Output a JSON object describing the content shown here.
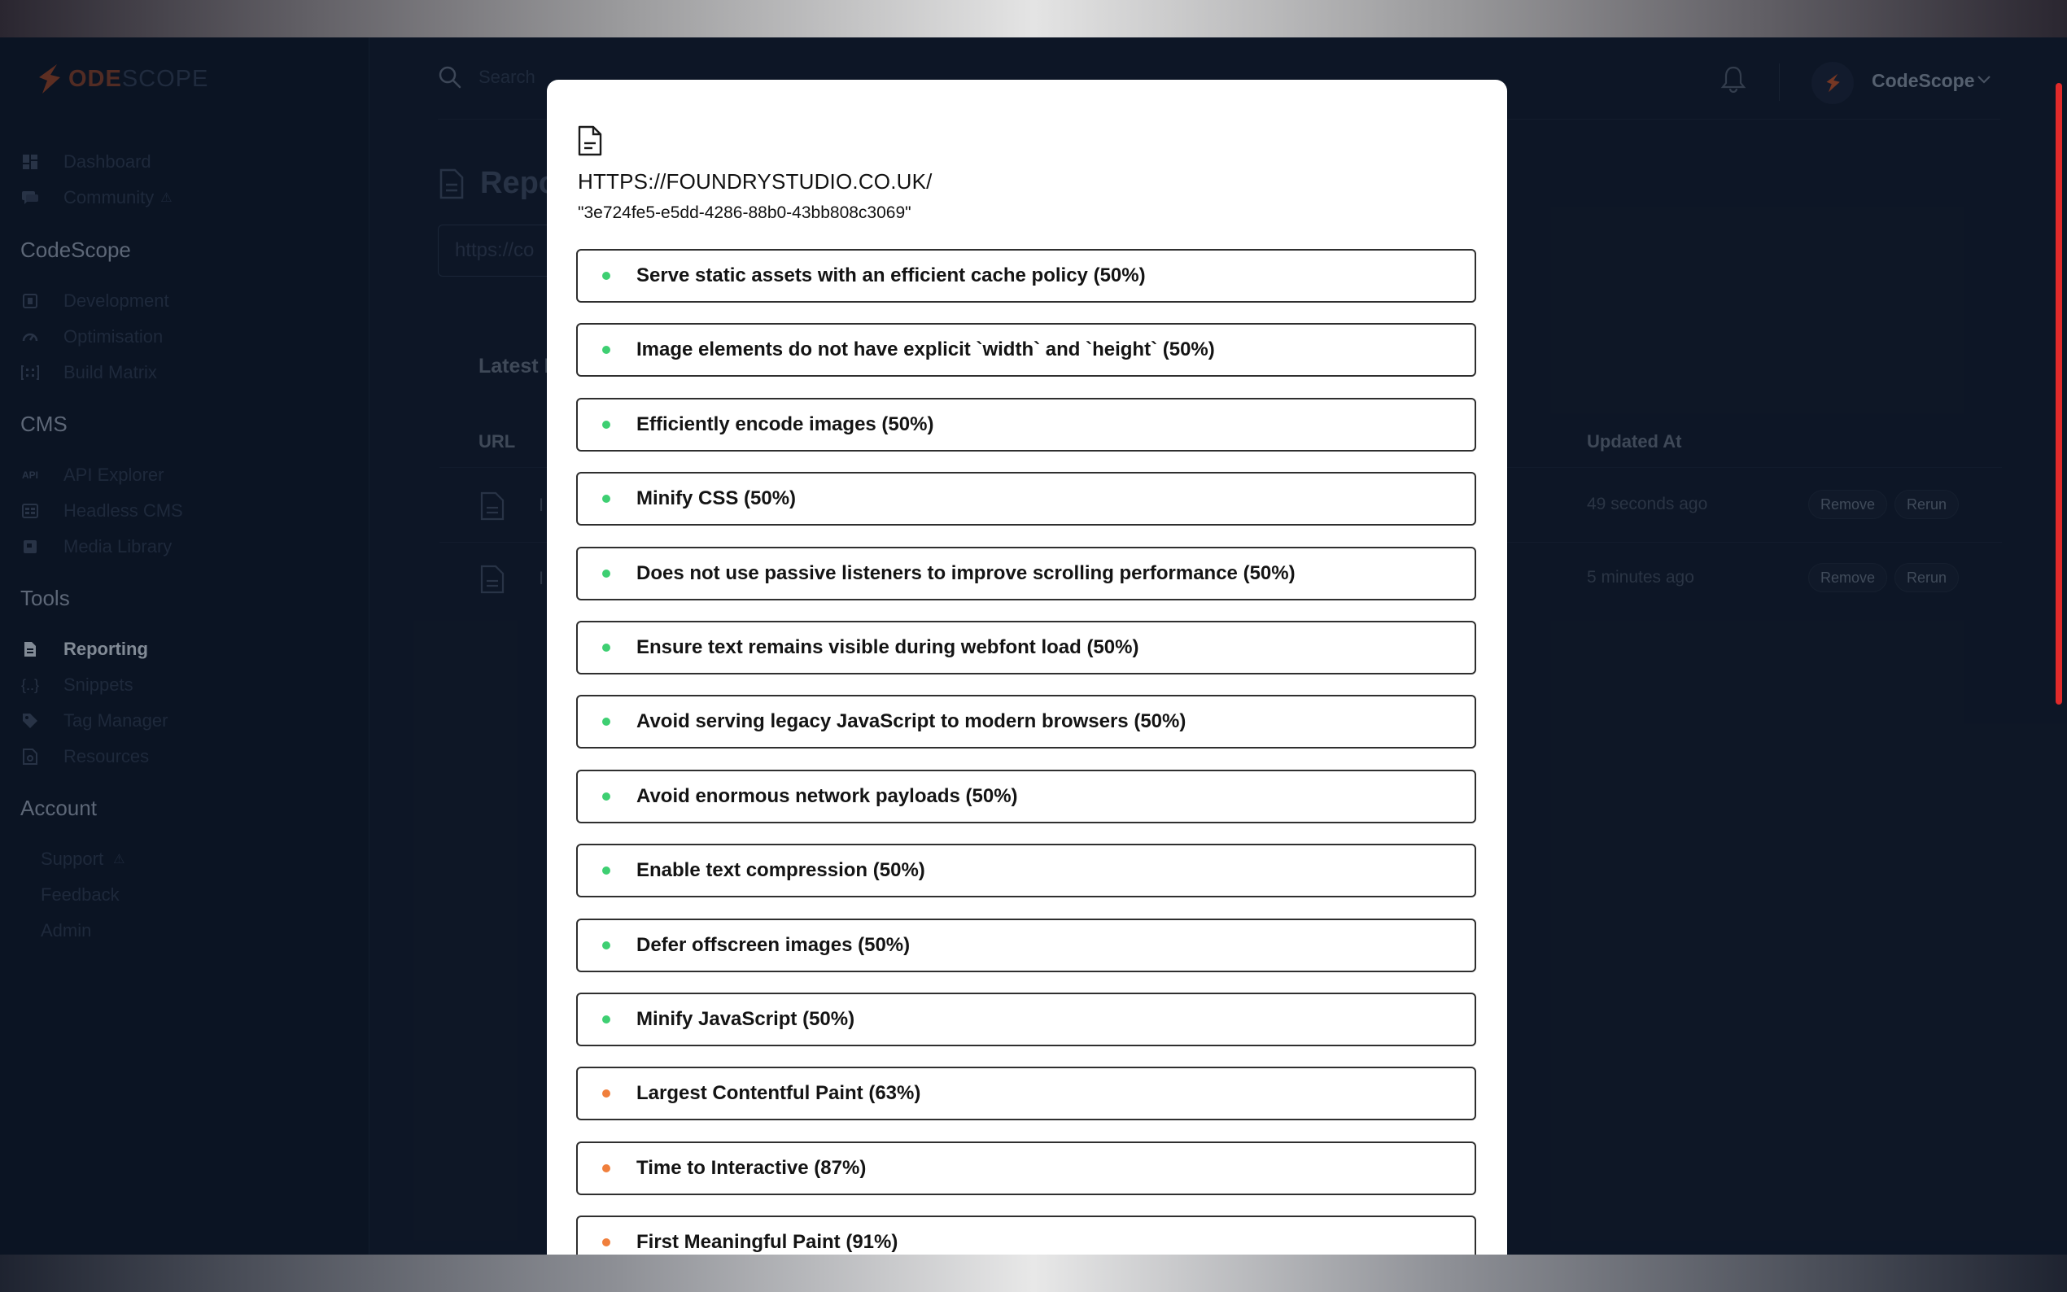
{
  "brand": {
    "logo_text_accent": "ODE",
    "logo_text_rest": "SCOPE",
    "accent_color": "#e2622c"
  },
  "sidebar": {
    "top_items": [
      {
        "label": "Dashboard",
        "icon": "grid-icon"
      },
      {
        "label": "Community",
        "icon": "chat-icon"
      }
    ],
    "sections": [
      {
        "title": "CodeScope",
        "items": [
          {
            "label": "Development",
            "icon": "code-box-icon"
          },
          {
            "label": "Optimisation",
            "icon": "gauge-icon"
          },
          {
            "label": "Build Matrix",
            "icon": "matrix-icon"
          }
        ]
      },
      {
        "title": "CMS",
        "items": [
          {
            "label": "API Explorer",
            "icon": "api-icon"
          },
          {
            "label": "Headless CMS",
            "icon": "cms-icon"
          },
          {
            "label": "Media Library",
            "icon": "media-icon"
          }
        ]
      },
      {
        "title": "Tools",
        "items": [
          {
            "label": "Reporting",
            "icon": "report-icon",
            "active": true
          },
          {
            "label": "Snippets",
            "icon": "braces-icon"
          },
          {
            "label": "Tag Manager",
            "icon": "tag-icon"
          },
          {
            "label": "Resources",
            "icon": "resources-icon"
          }
        ]
      },
      {
        "title": "Account",
        "items": [
          {
            "label": "Support"
          },
          {
            "label": "Feedback"
          },
          {
            "label": "Admin"
          }
        ]
      }
    ]
  },
  "header": {
    "search_placeholder": "Search",
    "user_name": "CodeScope"
  },
  "page": {
    "title": "Repo",
    "url_input_value": "https://co",
    "latest_label": "Latest I",
    "columns": {
      "url": "URL",
      "updated": "Updated At"
    },
    "rows": [
      {
        "prefix": "I",
        "updated": "49 seconds ago",
        "remove": "Remove",
        "rerun": "Rerun"
      },
      {
        "prefix": "I",
        "updated": "5 minutes ago",
        "remove": "Remove",
        "rerun": "Rerun"
      }
    ]
  },
  "modal": {
    "title": "HTTPS://FOUNDRYSTUDIO.CO.UK/",
    "subtitle": "\"3e724fe5-e5dd-4286-88b0-43bb808c3069\"",
    "status_colors": {
      "pass": "#3ecf72",
      "average": "#f07f3c"
    },
    "audits": [
      {
        "label": "Serve static assets with an efficient cache policy (50%)",
        "status": "pass"
      },
      {
        "label": "Image elements do not have explicit `width` and `height` (50%)",
        "status": "pass"
      },
      {
        "label": "Efficiently encode images (50%)",
        "status": "pass"
      },
      {
        "label": "Minify CSS (50%)",
        "status": "pass"
      },
      {
        "label": "Does not use passive listeners to improve scrolling performance (50%)",
        "status": "pass"
      },
      {
        "label": "Ensure text remains visible during webfont load (50%)",
        "status": "pass"
      },
      {
        "label": "Avoid serving legacy JavaScript to modern browsers (50%)",
        "status": "pass"
      },
      {
        "label": "Avoid enormous network payloads (50%)",
        "status": "pass"
      },
      {
        "label": "Enable text compression (50%)",
        "status": "pass"
      },
      {
        "label": "Defer offscreen images (50%)",
        "status": "pass"
      },
      {
        "label": "Minify JavaScript (50%)",
        "status": "pass"
      },
      {
        "label": "Largest Contentful Paint (63%)",
        "status": "average"
      },
      {
        "label": "Time to Interactive (87%)",
        "status": "average"
      },
      {
        "label": "First Meaningful Paint (91%)",
        "status": "average"
      }
    ]
  }
}
